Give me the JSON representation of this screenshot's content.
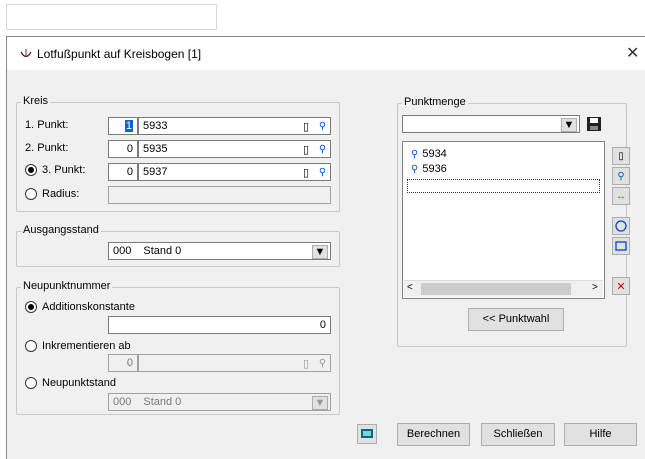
{
  "title": "Lotfußpunkt auf Kreisbogen [1]",
  "kreis": {
    "legend": "Kreis",
    "p1": {
      "label": "1. Punkt:",
      "num": "1",
      "id": "5933"
    },
    "p2": {
      "label": "2. Punkt:",
      "num": "0",
      "id": "5935"
    },
    "p3": {
      "label": "3. Punkt:",
      "num": "0",
      "id": "5937"
    },
    "radius_label": "Radius:",
    "selected_mode": "3. Punkt"
  },
  "ausgangsstand": {
    "legend": "Ausgangsstand",
    "code": "000",
    "name": "Stand 0"
  },
  "neupunkt": {
    "legend": "Neupunktnummer",
    "opt_add": "Additionskonstante",
    "add_value": "0",
    "opt_inc": "Inkrementieren ab",
    "inc_value": "0",
    "opt_stand": "Neupunktstand",
    "stand_code": "000",
    "stand_name": "Stand 0",
    "selected": "Additionskonstante"
  },
  "punktmenge": {
    "legend": "Punktmenge",
    "items": [
      "5934",
      "5936"
    ],
    "punktwahl_label": "<< Punktwahl"
  },
  "buttons": {
    "berechnen": "Berechnen",
    "schliessen": "Schließen",
    "hilfe": "Hilfe"
  },
  "colors": {
    "accent": "#0055cc",
    "delete": "#cc0000",
    "green": "#2a8a2a"
  }
}
